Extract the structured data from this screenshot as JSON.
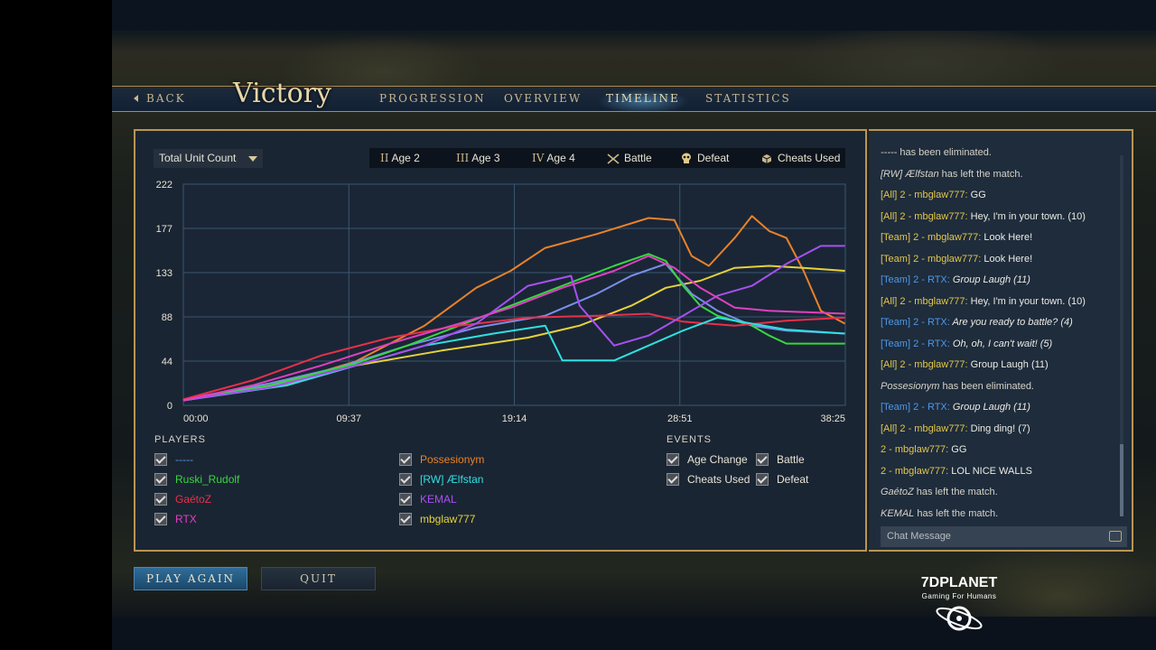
{
  "nav": {
    "back": "BACK",
    "title": "Victory",
    "tabs": [
      "PROGRESSION",
      "OVERVIEW",
      "TIMELINE",
      "STATISTICS"
    ],
    "active_tab": "TIMELINE"
  },
  "metric_select": {
    "value": "Total Unit Count"
  },
  "event_legend": [
    {
      "symbol": "II",
      "label": "Age 2"
    },
    {
      "symbol": "III",
      "label": "Age 3"
    },
    {
      "symbol": "IV",
      "label": "Age 4"
    },
    {
      "icon": "crossed-swords-icon",
      "label": "Battle"
    },
    {
      "icon": "skull-icon",
      "label": "Defeat"
    },
    {
      "icon": "cube-icon",
      "label": "Cheats Used"
    }
  ],
  "chart_data": {
    "type": "line",
    "title": "",
    "ylabel": "Total Unit Count",
    "xlabel": "",
    "x_tick_labels": [
      "00:00",
      "09:37",
      "19:14",
      "28:51",
      "38:25"
    ],
    "y_tick_labels": [
      "0",
      "44",
      "88",
      "133",
      "177",
      "222"
    ],
    "ylim": [
      0,
      222
    ],
    "xlim_minutes": [
      0,
      38.42
    ],
    "grid": true,
    "series": [
      {
        "name": "Possesionym",
        "color": "#e8822a",
        "points": [
          [
            0,
            5
          ],
          [
            5,
            18
          ],
          [
            10,
            44
          ],
          [
            14,
            80
          ],
          [
            17,
            118
          ],
          [
            19,
            135
          ],
          [
            21,
            158
          ],
          [
            24,
            172
          ],
          [
            27,
            188
          ],
          [
            28.5,
            186
          ],
          [
            29.5,
            150
          ],
          [
            30.5,
            140
          ],
          [
            32,
            168
          ],
          [
            33,
            190
          ],
          [
            34,
            175
          ],
          [
            35,
            168
          ],
          [
            36,
            135
          ],
          [
            37,
            95
          ],
          [
            38.4,
            82
          ]
        ]
      },
      {
        "name": "mbglaw777",
        "color": "#e5d23a",
        "points": [
          [
            0,
            5
          ],
          [
            6,
            22
          ],
          [
            10,
            40
          ],
          [
            15,
            55
          ],
          [
            20,
            68
          ],
          [
            23,
            80
          ],
          [
            26,
            100
          ],
          [
            28,
            118
          ],
          [
            30,
            125
          ],
          [
            32,
            138
          ],
          [
            34,
            140
          ],
          [
            36,
            138
          ],
          [
            38.4,
            135
          ]
        ]
      },
      {
        "name": "-----",
        "color": "#7a8fe8",
        "points": [
          [
            0,
            6
          ],
          [
            5,
            22
          ],
          [
            9,
            38
          ],
          [
            13,
            60
          ],
          [
            17,
            78
          ],
          [
            21,
            90
          ],
          [
            24,
            112
          ],
          [
            26,
            130
          ],
          [
            28,
            142
          ],
          [
            29.5,
            112
          ],
          [
            31,
            95
          ],
          [
            33,
            80
          ],
          [
            35,
            75
          ],
          [
            38.4,
            72
          ]
        ]
      },
      {
        "name": "Ruski_Rudolf",
        "color": "#38d640",
        "points": [
          [
            0,
            5
          ],
          [
            5,
            20
          ],
          [
            10,
            42
          ],
          [
            13,
            60
          ],
          [
            16,
            80
          ],
          [
            19,
            100
          ],
          [
            22,
            120
          ],
          [
            25,
            140
          ],
          [
            27,
            152
          ],
          [
            28,
            145
          ],
          [
            29,
            120
          ],
          [
            30,
            100
          ],
          [
            31,
            90
          ],
          [
            33,
            80
          ],
          [
            34,
            70
          ],
          [
            35,
            62
          ],
          [
            38.4,
            62
          ]
        ]
      },
      {
        "name": "GaétoZ",
        "color": "#e8304a",
        "points": [
          [
            0,
            6
          ],
          [
            4,
            25
          ],
          [
            8,
            50
          ],
          [
            12,
            68
          ],
          [
            16,
            80
          ],
          [
            20,
            88
          ],
          [
            24,
            90
          ],
          [
            27,
            92
          ],
          [
            29,
            84
          ],
          [
            32,
            80
          ],
          [
            35,
            85
          ],
          [
            38.4,
            88
          ]
        ]
      },
      {
        "name": "[RW] Ælfstan",
        "color": "#2fe0e0",
        "points": [
          [
            0,
            5
          ],
          [
            6,
            20
          ],
          [
            10,
            40
          ],
          [
            14,
            60
          ],
          [
            18,
            72
          ],
          [
            21,
            80
          ],
          [
            22,
            45
          ],
          [
            25,
            45
          ],
          [
            27,
            60
          ],
          [
            29,
            75
          ],
          [
            31,
            88
          ],
          [
            33,
            82
          ],
          [
            35,
            76
          ],
          [
            38.4,
            72
          ]
        ]
      },
      {
        "name": "KEMAL",
        "color": "#a850f0",
        "points": [
          [
            0,
            5
          ],
          [
            5,
            18
          ],
          [
            10,
            40
          ],
          [
            14,
            60
          ],
          [
            17,
            82
          ],
          [
            20,
            120
          ],
          [
            22.5,
            130
          ],
          [
            23,
            100
          ],
          [
            24,
            80
          ],
          [
            25,
            60
          ],
          [
            27,
            70
          ],
          [
            29,
            90
          ],
          [
            31,
            110
          ],
          [
            33,
            120
          ],
          [
            35,
            142
          ],
          [
            37,
            160
          ],
          [
            38.4,
            160
          ]
        ]
      },
      {
        "name": "RTX",
        "color": "#e040c0",
        "points": [
          [
            0,
            5
          ],
          [
            4,
            20
          ],
          [
            8,
            40
          ],
          [
            12,
            62
          ],
          [
            16,
            82
          ],
          [
            19,
            98
          ],
          [
            22,
            118
          ],
          [
            25,
            135
          ],
          [
            27,
            150
          ],
          [
            28.5,
            138
          ],
          [
            30,
            118
          ],
          [
            32,
            98
          ],
          [
            34,
            95
          ],
          [
            38.4,
            92
          ]
        ]
      }
    ]
  },
  "players_header": "PLAYERS",
  "players": [
    {
      "name": "-----",
      "color": "#4f98e8",
      "checked": true
    },
    {
      "name": "Possesionym",
      "color": "#e8822a",
      "checked": true
    },
    {
      "name": "Ruski_Rudolf",
      "color": "#38d640",
      "checked": true
    },
    {
      "name": "[RW] Ælfstan",
      "color": "#2fe0e0",
      "checked": true
    },
    {
      "name": "GaétoZ",
      "color": "#e8304a",
      "checked": true
    },
    {
      "name": "KEMAL",
      "color": "#a850f0",
      "checked": true
    },
    {
      "name": "RTX",
      "color": "#e040c0",
      "checked": true
    },
    {
      "name": "mbglaw777",
      "color": "#e5d23a",
      "checked": true
    }
  ],
  "events_header": "EVENTS",
  "events": [
    {
      "label": "Age Change",
      "checked": true
    },
    {
      "label": "Battle",
      "checked": true
    },
    {
      "label": "Cheats Used",
      "checked": true
    },
    {
      "label": "Defeat",
      "checked": true
    }
  ],
  "chat": [
    {
      "name": "-----",
      "name_style": "ital",
      "text": " has been eliminated."
    },
    {
      "name": "[RW] Ælfstan",
      "name_style": "ital",
      "text": " has left the match."
    },
    {
      "name": "[All] 2 - mbglaw777:",
      "name_style": "all",
      "text": " GG"
    },
    {
      "name": "[All] 2 - mbglaw777:",
      "name_style": "all",
      "text": " Hey, I'm in your town. (10)"
    },
    {
      "name": "[Team] 2 - mbglaw777:",
      "name_style": "all",
      "text": " Look Here!"
    },
    {
      "name": "[Team] 2 - mbglaw777:",
      "name_style": "all",
      "text": " Look Here!"
    },
    {
      "name": "[Team] 2 - RTX:",
      "name_style": "team",
      "text": " Group Laugh (11)"
    },
    {
      "name": "[All] 2 - mbglaw777:",
      "name_style": "all",
      "text": " Hey, I'm in your town. (10)"
    },
    {
      "name": "[Team] 2 - RTX:",
      "name_style": "team",
      "text": " Are you ready to battle? (4)"
    },
    {
      "name": "[Team] 2 - RTX:",
      "name_style": "team",
      "text": " Oh, oh, I can't wait! (5)"
    },
    {
      "name": "[All] 2 - mbglaw777:",
      "name_style": "all",
      "text": " Group Laugh (11)"
    },
    {
      "name": "Possesionym",
      "name_style": "ital",
      "text": " has been eliminated."
    },
    {
      "name": "[Team] 2 - RTX:",
      "name_style": "team",
      "text": " Group Laugh (11)"
    },
    {
      "name": "[All] 2 - mbglaw777:",
      "name_style": "all",
      "text": " Ding ding! (7)"
    },
    {
      "name": "2 - mbglaw777:",
      "name_style": "all",
      "text": " GG"
    },
    {
      "name": "2 - mbglaw777:",
      "name_style": "all",
      "text": " LOL NICE WALLS"
    },
    {
      "name": "GaétoZ",
      "name_style": "ital",
      "text": " has left the match."
    },
    {
      "name": "KEMAL",
      "name_style": "ital",
      "text": " has left the match."
    }
  ],
  "chat_input": {
    "placeholder": "Chat Message"
  },
  "buttons": {
    "play_again": "PLAY AGAIN",
    "quit": "QUIT"
  },
  "brand": {
    "name": "7DPLANET",
    "tagline": "Gaming For Humans"
  },
  "colors": {
    "gold_border": "#b99554",
    "panel": "#1a2533",
    "accent_blue": "#2f6d9a"
  }
}
